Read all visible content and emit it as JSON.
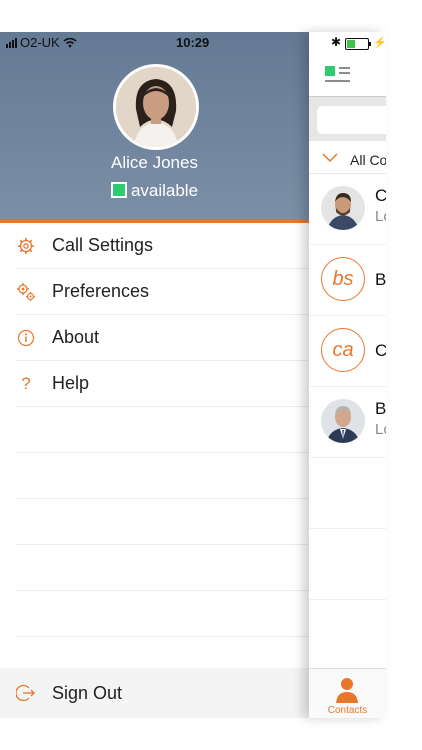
{
  "status_bar": {
    "carrier": "O2-UK",
    "time": "10:29"
  },
  "profile": {
    "name": "Alice Jones",
    "presence": "available",
    "presence_color": "#2ecc71"
  },
  "menu": {
    "items": [
      {
        "label": "Call Settings",
        "icon": "gear-icon"
      },
      {
        "label": "Preferences",
        "icon": "gears-icon"
      },
      {
        "label": "About",
        "icon": "info-icon"
      },
      {
        "label": "Help",
        "icon": "question-icon"
      }
    ],
    "sign_out": "Sign Out"
  },
  "contacts_panel": {
    "filter": "All Co",
    "contacts": [
      {
        "name": "C",
        "sub": "Lo"
      },
      {
        "initials": "bs",
        "name": "B"
      },
      {
        "initials": "ca",
        "name": "C"
      },
      {
        "name": "B",
        "sub": "Lo"
      }
    ],
    "tab_label": "Contacts"
  },
  "colors": {
    "accent": "#e8772e",
    "header_bg": "#6f839b"
  }
}
